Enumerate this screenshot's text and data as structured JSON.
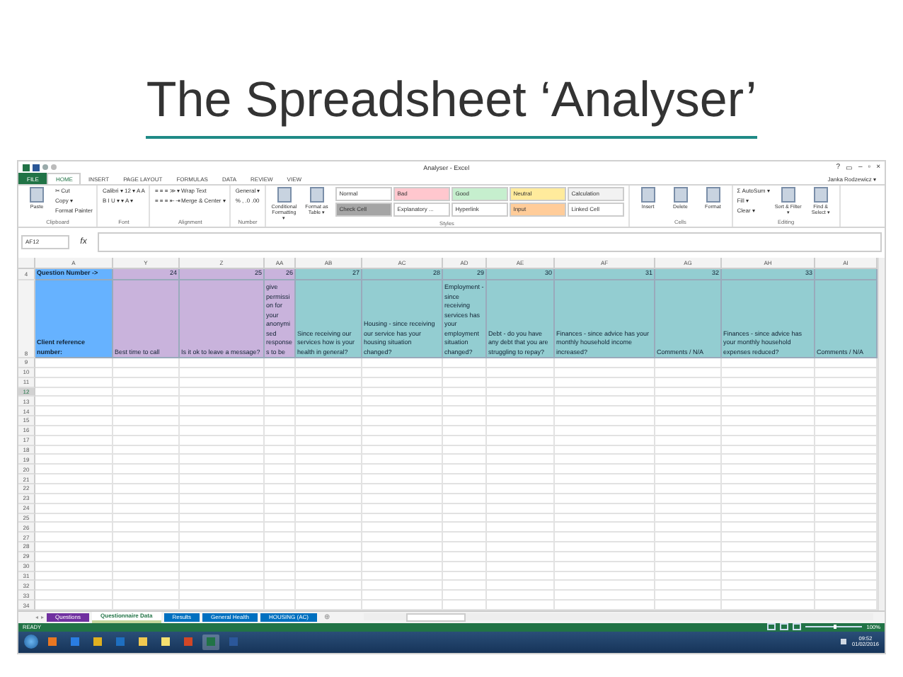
{
  "slide": {
    "title": "The Spreadsheet ‘Analyser’"
  },
  "window": {
    "title": "Analyser - Excel",
    "user": "Janka Rodzewicz ▾",
    "controls": [
      "?",
      "▭",
      "–",
      "▫",
      "×"
    ]
  },
  "ribbon_tabs": [
    {
      "label": "FILE",
      "selected": false,
      "kind": "file"
    },
    {
      "label": "HOME",
      "selected": true,
      "kind": "tab"
    },
    {
      "label": "INSERT",
      "selected": false,
      "kind": "tab"
    },
    {
      "label": "PAGE LAYOUT",
      "selected": false,
      "kind": "tab"
    },
    {
      "label": "FORMULAS",
      "selected": false,
      "kind": "tab"
    },
    {
      "label": "DATA",
      "selected": false,
      "kind": "tab"
    },
    {
      "label": "REVIEW",
      "selected": false,
      "kind": "tab"
    },
    {
      "label": "VIEW",
      "selected": false,
      "kind": "tab"
    }
  ],
  "ribbon_groups": [
    {
      "label": "Clipboard",
      "items": [
        {
          "kind": "big",
          "label": "Paste"
        },
        {
          "kind": "stack",
          "lines": [
            "✂ Cut",
            "Copy ▾",
            "Format Painter"
          ]
        }
      ]
    },
    {
      "label": "Font",
      "items": [
        {
          "kind": "stack",
          "lines": [
            "Calibri ▾  12 ▾  A A",
            "B  I  U ▾  ▾  A ▾"
          ]
        }
      ]
    },
    {
      "label": "Alignment",
      "items": [
        {
          "kind": "stack",
          "lines": [
            "≡ ≡ ≡  ≫ ▾  Wrap Text",
            "≡ ≡ ≡  ⇤ ⇥  Merge & Center ▾"
          ]
        }
      ]
    },
    {
      "label": "Number",
      "items": [
        {
          "kind": "stack",
          "lines": [
            "General ▾",
            "% ,  .0 .00"
          ]
        }
      ]
    },
    {
      "label": "Styles",
      "items": [
        {
          "kind": "big",
          "label": "Conditional Formatting ▾"
        },
        {
          "kind": "big",
          "label": "Format as Table ▾"
        },
        {
          "kind": "styles",
          "cells": [
            {
              "label": "Normal",
              "color": "#ffffff"
            },
            {
              "label": "Bad",
              "color": "#ffc7ce"
            },
            {
              "label": "Good",
              "color": "#c6efce"
            },
            {
              "label": "Neutral",
              "color": "#ffeb9c"
            },
            {
              "label": "Calculation",
              "color": "#f2f2f2"
            },
            {
              "label": "Check Cell",
              "color": "#a5a5a5"
            },
            {
              "label": "Explanatory ...",
              "color": "#ffffff"
            },
            {
              "label": "Hyperlink",
              "color": "#ffffff"
            },
            {
              "label": "Input",
              "color": "#ffcc99"
            },
            {
              "label": "Linked Cell",
              "color": "#ffffff"
            }
          ]
        }
      ]
    },
    {
      "label": "Cells",
      "items": [
        {
          "kind": "big",
          "label": "Insert"
        },
        {
          "kind": "big",
          "label": "Delete"
        },
        {
          "kind": "big",
          "label": "Format"
        }
      ]
    },
    {
      "label": "Editing",
      "items": [
        {
          "kind": "stack",
          "lines": [
            "Σ AutoSum ▾",
            "Fill ▾",
            "Clear ▾"
          ]
        },
        {
          "kind": "big",
          "label": "Sort & Filter ▾"
        },
        {
          "kind": "big",
          "label": "Find & Select ▾"
        }
      ]
    }
  ],
  "name_box": "AF12",
  "formula_label": "fx",
  "columns": [
    {
      "letter": "A",
      "color": "#66b2ff"
    },
    {
      "letter": "Y",
      "color": "#c9b3dc"
    },
    {
      "letter": "Z",
      "color": "#c9b3dc"
    },
    {
      "letter": "AA",
      "color": "#c9b3dc"
    },
    {
      "letter": "AB",
      "color": "#93cdd1"
    },
    {
      "letter": "AC",
      "color": "#93cdd1"
    },
    {
      "letter": "AD",
      "color": "#93cdd1"
    },
    {
      "letter": "AE",
      "color": "#93cdd1"
    },
    {
      "letter": "AF",
      "color": "#93cdd1"
    },
    {
      "letter": "AG",
      "color": "#93cdd1"
    },
    {
      "letter": "AH",
      "color": "#93cdd1"
    },
    {
      "letter": "AI",
      "color": "#93cdd1"
    }
  ],
  "header_rows": [
    {
      "number": "4",
      "kind": "numbers",
      "cells": [
        "Question Number ->",
        "24",
        "25",
        "26",
        "27",
        "28",
        "29",
        "30",
        "31",
        "32",
        "33",
        ""
      ]
    },
    {
      "number": "8",
      "kind": "questions",
      "cells": [
        "Client reference number:",
        "Best time to call",
        "Is it ok to leave a message?",
        "give permission for your anonymised responses to be",
        "Since receiving our services how is your health in general?",
        "Housing - since receiving our service has your housing situation changed?",
        "Employment - since receiving services has your employment situation changed?",
        "Debt - do you have any debt that you are struggling to repay?",
        "Finances - since advice has your monthly household income increased?",
        "Comments / N/A",
        "Finances - since advice has your monthly household expenses reduced?",
        "Comments / N/A"
      ]
    }
  ],
  "rows": [
    {
      "number": "9",
      "selected": false
    },
    {
      "number": "10",
      "selected": false
    },
    {
      "number": "11",
      "selected": false
    },
    {
      "number": "12",
      "selected": true
    },
    {
      "number": "13",
      "selected": false
    },
    {
      "number": "14",
      "selected": false
    },
    {
      "number": "15",
      "selected": false
    },
    {
      "number": "16",
      "selected": false
    },
    {
      "number": "17",
      "selected": false
    },
    {
      "number": "18",
      "selected": false
    },
    {
      "number": "19",
      "selected": false
    },
    {
      "number": "20",
      "selected": false
    },
    {
      "number": "21",
      "selected": false
    },
    {
      "number": "22",
      "selected": false
    },
    {
      "number": "23",
      "selected": false
    },
    {
      "number": "24",
      "selected": false
    },
    {
      "number": "25",
      "selected": false
    },
    {
      "number": "26",
      "selected": false
    },
    {
      "number": "27",
      "selected": false
    },
    {
      "number": "28",
      "selected": false
    },
    {
      "number": "29",
      "selected": false
    },
    {
      "number": "30",
      "selected": false
    },
    {
      "number": "31",
      "selected": false
    },
    {
      "number": "32",
      "selected": false
    },
    {
      "number": "33",
      "selected": false
    },
    {
      "number": "34",
      "selected": false
    }
  ],
  "sheet_tabs": [
    {
      "label": "Questions",
      "color": "#7030a0",
      "selected": false
    },
    {
      "label": "Questionnaire Data",
      "color": "#c4d79b",
      "selected": true
    },
    {
      "label": "Results",
      "color": "#0070c0",
      "selected": false
    },
    {
      "label": "General Health",
      "color": "#0070c0",
      "selected": false
    },
    {
      "label": "HOUSING (AC)",
      "color": "#0070c0",
      "selected": false
    }
  ],
  "sheet_nav": {
    "prev": "◂",
    "next": "▸",
    "add": "⊕"
  },
  "status_bar": {
    "text": "READY",
    "zoom": "100%",
    "zoom_slider": {
      "level": 0.5
    }
  },
  "taskbar": {
    "time": "09:52",
    "date": "01/02/2016"
  }
}
